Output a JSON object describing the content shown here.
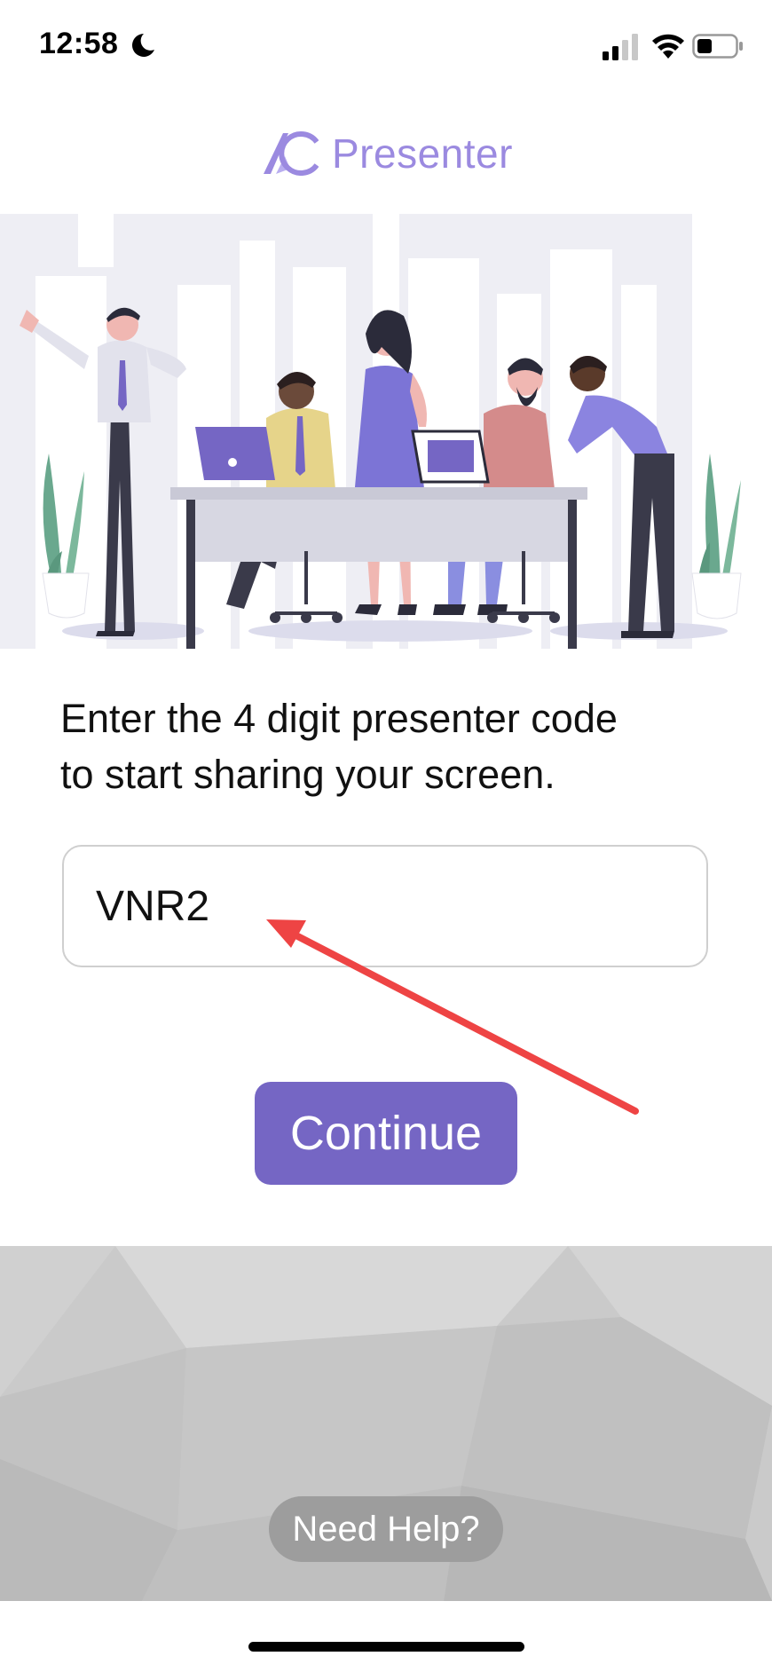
{
  "status_bar": {
    "time": "12:58",
    "icons": [
      "moon-icon",
      "cellular-signal-icon",
      "wifi-icon",
      "battery-icon"
    ]
  },
  "brand": {
    "logo_mark": "logo-icon",
    "name": "Presenter",
    "accent_color": "#9b8ae0"
  },
  "main": {
    "instruction_line1": "Enter the 4 digit presenter code",
    "instruction_line2": "to start sharing your screen.",
    "code_input_value": "VNR2",
    "continue_label": "Continue",
    "button_color": "#7566c4"
  },
  "annotation": {
    "arrow_color": "#ee4444"
  },
  "footer": {
    "help_label": "Need Help?"
  }
}
